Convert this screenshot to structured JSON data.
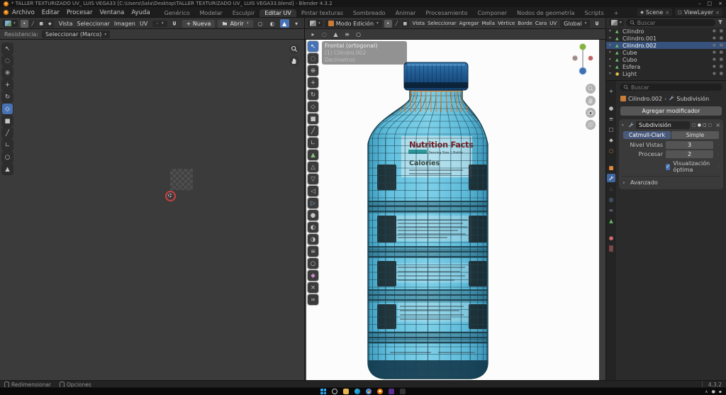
{
  "window": {
    "title": "* TALLER TEXTURIZADO UV_ LUIS VEGA33 [C:\\Users\\Sala\\Desktop\\TALLER TEXTURIZADO UV_ LUIS VEGA33.blend] - Blender 4.3.2",
    "controls": {
      "minimize": "–",
      "maximize": "□",
      "close": "×"
    }
  },
  "menubar": {
    "menus": [
      "Archivo",
      "Editar",
      "Procesar",
      "Ventana",
      "Ayuda"
    ],
    "workspaces": [
      "Genérico",
      "Modelar",
      "Esculpir",
      "Editar UV",
      "Pintar texturas",
      "Sombreado",
      "Animar",
      "Procesamiento",
      "Componer",
      "Nodos de geometría",
      "Scripts",
      "+"
    ],
    "active_workspace": "Editar UV",
    "scene_label": "Scene",
    "viewlayer_label": "ViewLayer"
  },
  "uv": {
    "menus": [
      "Vista",
      "Seleccionar",
      "Imagen",
      "UV"
    ],
    "new_button": "+ Nueva",
    "open_button": "Abrir",
    "tool_label": "Resistencia:",
    "tool_value": "Seleccionar (Marco)"
  },
  "vp": {
    "mode": "Modo Edición",
    "menus": [
      "Vista",
      "Seleccionar",
      "Agregar",
      "Malla",
      "Vértice",
      "Borde",
      "Cara",
      "UV"
    ],
    "orientation": "Global",
    "options_label": "Opciones",
    "overlay": [
      "Frontal (ortogonal)",
      "(1) Cilindro.002",
      "Decímetros"
    ]
  },
  "outliner": {
    "search_placeholder": "Buscar",
    "items": [
      {
        "name": "Cilindro",
        "icon": "mesh",
        "selected": false
      },
      {
        "name": "Cilindro.001",
        "icon": "mesh",
        "selected": false
      },
      {
        "name": "Cilindro.002",
        "icon": "mesh",
        "selected": true
      },
      {
        "name": "Cube",
        "icon": "mesh",
        "selected": false
      },
      {
        "name": "Cubo",
        "icon": "mesh",
        "selected": false
      },
      {
        "name": "Esfera",
        "icon": "mesh",
        "selected": false
      },
      {
        "name": "Light",
        "icon": "light",
        "selected": false
      }
    ]
  },
  "props": {
    "search_placeholder": "Buscar",
    "object": "Cilindro.002",
    "modifier": "Subdivisión",
    "add_modifier": "Agregar modificador",
    "algo_left": "Catmull-Clark",
    "algo_right": "Simple",
    "rows": [
      {
        "label": "Nivel Vistas",
        "value": "3"
      },
      {
        "label": "Procesar",
        "value": "2"
      }
    ],
    "optimal": "Visualización óptima",
    "advanced": "Avanzado"
  },
  "status": {
    "resize": "Redimensionar",
    "options": "Opciones",
    "version": "4.3.2"
  },
  "bottle": {
    "title": "Nutrition Facts",
    "serving": "Serving Size 1 Bottle",
    "calories": "Calories"
  },
  "colors": {
    "accent": "#4772b3",
    "selection_orange": "#e87722",
    "bottle_blue": "#5cb9d8"
  }
}
